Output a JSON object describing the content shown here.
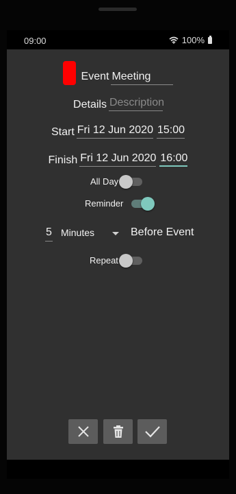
{
  "status_bar": {
    "time": "09:00",
    "battery": "100%"
  },
  "event": {
    "color": "#ff0000",
    "name_label": "Event",
    "name_value": "Meeting",
    "details_label": "Details",
    "details_placeholder": "Description",
    "start_label": "Start",
    "start_date": "Fri 12 Jun 2020",
    "start_time": "15:00",
    "finish_label": "Finish",
    "finish_date": "Fri 12 Jun 2020",
    "finish_time": "16:00"
  },
  "toggles": {
    "all_day_label": "All Day",
    "all_day": false,
    "reminder_label": "Reminder",
    "reminder": true,
    "repeat_label": "Repeat",
    "repeat": false
  },
  "reminder": {
    "amount": "5",
    "unit": "Minutes",
    "suffix": "Before Event"
  },
  "actions": [
    {
      "name": "cancel",
      "icon": "close-icon"
    },
    {
      "name": "delete",
      "icon": "trash-icon"
    },
    {
      "name": "save",
      "icon": "check-icon"
    }
  ],
  "colors": {
    "accent": "#7fc9bd",
    "background": "#303030",
    "button": "#5c5c5c"
  }
}
